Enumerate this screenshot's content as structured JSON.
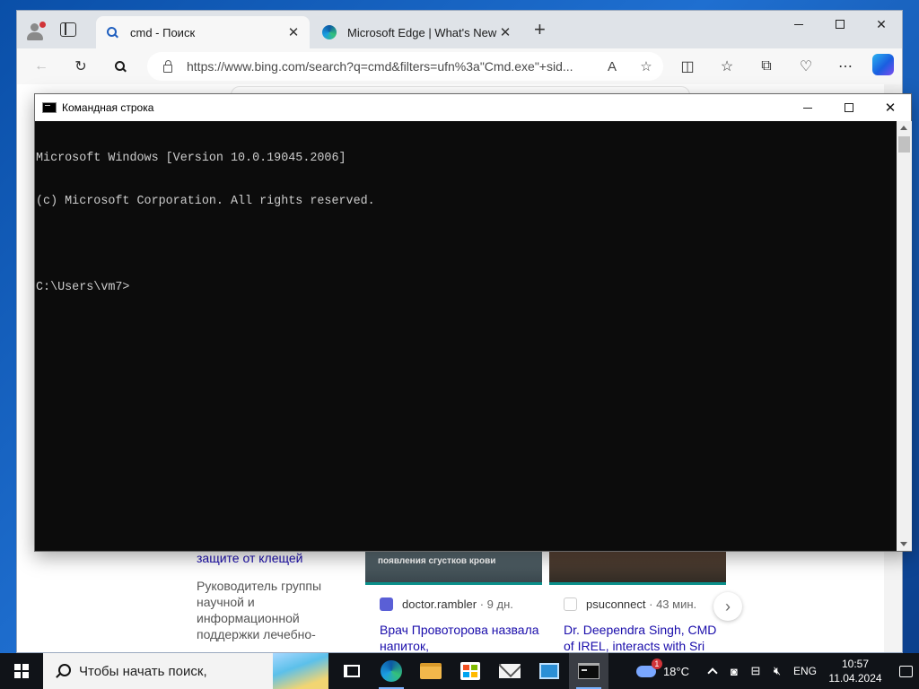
{
  "edge": {
    "tabs": [
      {
        "title": "cmd - Поиск",
        "icon": "search-icon"
      },
      {
        "title": "Microsoft Edge | What's New",
        "icon": "edge-logo-icon"
      }
    ],
    "new_tab_label": "+",
    "close_label": "✕",
    "url": "https://www.bing.com/search?q=cmd&filters=ufn%3a\"Cmd.exe\"+sid...",
    "read_aloud_label": "A",
    "window_controls": {
      "minimize": "",
      "maximize": "",
      "close": "✕"
    }
  },
  "page": {
    "left_link": "защите от клещей",
    "left_snippet": "Руководитель группы научной и информационной поддержки лечебно-профилактических",
    "cards": [
      {
        "thumb_caption": "появления сгустков крови",
        "source": "doctor.rambler",
        "age": "· 9 дн.",
        "headline": "Врач Провоторова назвала напиток,"
      },
      {
        "thumb_caption": "",
        "source": "psuconnect",
        "age": "· 43 мин.",
        "headline": "Dr. Deependra Singh, CMD of IREL, interacts with Sri"
      }
    ],
    "next_label": "›"
  },
  "cmd": {
    "title": "Командная строка",
    "lines": [
      "Microsoft Windows [Version 10.0.19045.2006]",
      "(c) Microsoft Corporation. All rights reserved.",
      "",
      "C:\\Users\\vm7>"
    ]
  },
  "taskbar": {
    "search_placeholder": "Чтобы начать поиск,",
    "apps": [
      "task-view-icon",
      "edge-icon",
      "file-explorer-icon",
      "microsoft-store-icon",
      "mail-icon",
      "control-panel-icon",
      "cmd-icon"
    ],
    "weather_badge": "1",
    "temperature": "18°C",
    "language": "ENG",
    "time": "10:57",
    "date": "11.04.2024"
  },
  "colors": {
    "cmd_background": "#0c0c0c",
    "cmd_text": "#cccccc",
    "taskbar": "#101318",
    "link": "#1a0dab"
  }
}
